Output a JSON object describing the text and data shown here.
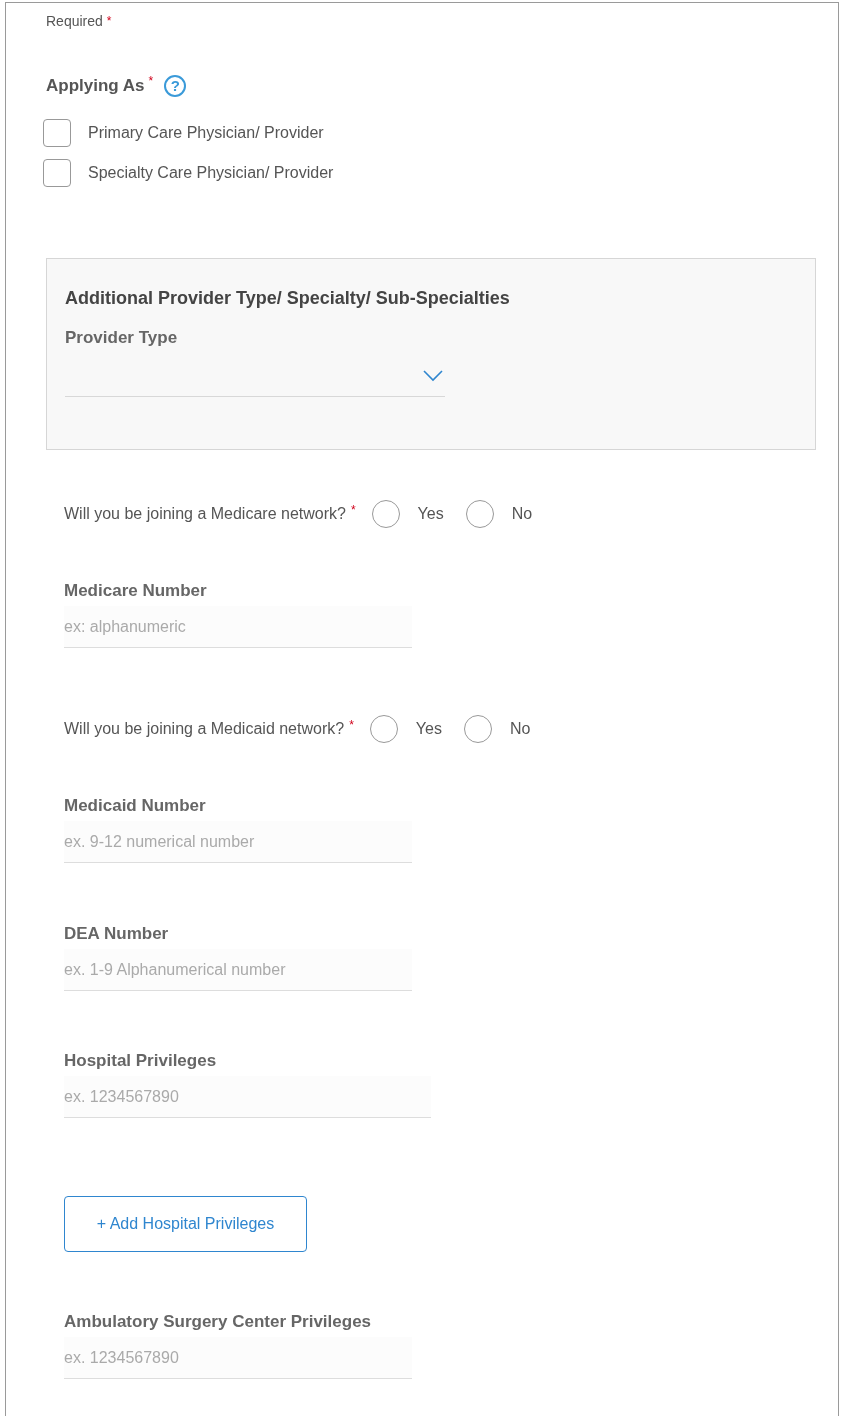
{
  "required_note": {
    "text": "Required",
    "mark": "*"
  },
  "applying_as": {
    "label": "Applying As",
    "mark": "*",
    "help": "?",
    "options": [
      {
        "label": "Primary Care Physician/ Provider",
        "checked": false
      },
      {
        "label": "Specialty Care Physician/ Provider",
        "checked": false
      }
    ]
  },
  "additional_panel": {
    "title": "Additional Provider Type/ Specialty/ Sub-Specialties",
    "provider_type": {
      "label": "Provider Type"
    }
  },
  "sections": [
    {
      "kind": "question",
      "text": "Will you be joining a Medicare network?",
      "mark": "*",
      "options": [
        {
          "label": "Yes",
          "selected": false
        },
        {
          "label": "No",
          "selected": false
        }
      ]
    },
    {
      "kind": "field",
      "label": "Medicare Number",
      "placeholder": "ex: alphanumeric"
    },
    {
      "kind": "question",
      "text": "Will you be joining a Medicaid network?",
      "mark": "*",
      "options": [
        {
          "label": "Yes",
          "selected": false
        },
        {
          "label": "No",
          "selected": false
        }
      ]
    },
    {
      "kind": "field",
      "label": "Medicaid Number",
      "placeholder": "ex. 9-12 numerical number"
    },
    {
      "kind": "field",
      "label": "DEA Number",
      "placeholder": "ex. 1-9 Alphanumerical number"
    },
    {
      "kind": "field",
      "label": "Hospital Privileges",
      "placeholder": "ex. 1234567890",
      "add_button": "+ Add Hospital Privileges"
    },
    {
      "kind": "field",
      "label": "Ambulatory Surgery Center Privileges",
      "placeholder": "ex. 1234567890"
    }
  ]
}
